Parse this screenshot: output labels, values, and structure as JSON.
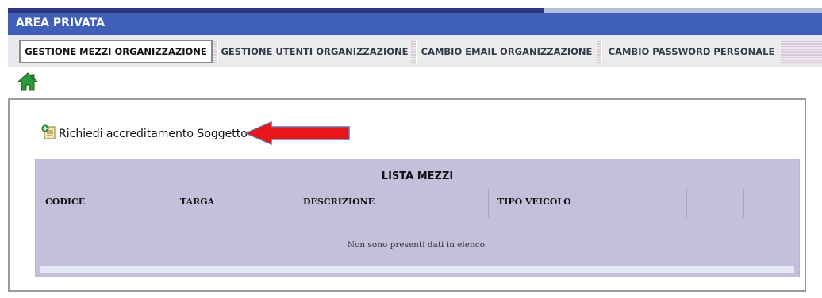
{
  "header": {
    "title": "AREA PRIVATA"
  },
  "tabs": [
    {
      "label": "GESTIONE MEZZI ORGANIZZAZIONE",
      "active": true
    },
    {
      "label": "GESTIONE UTENTI ORGANIZZAZIONE",
      "active": false
    },
    {
      "label": "CAMBIO EMAIL ORGANIZZAZIONE",
      "active": false
    },
    {
      "label": "CAMBIO PASSWORD PERSONALE",
      "active": false
    }
  ],
  "home": {
    "icon": "home-icon"
  },
  "action": {
    "icon": "document-add-icon",
    "label": "Richiedi accreditamento Soggetto"
  },
  "annotation": {
    "icon": "red-arrow-icon",
    "color": "#e8161a"
  },
  "list": {
    "title": "LISTA MEZZI",
    "columns": [
      "CODICE",
      "TARGA",
      "DESCRIZIONE",
      "TIPO VEICOLO"
    ],
    "empty_message": "Non sono presenti dati in elenco."
  },
  "colors": {
    "header": "#4060b8",
    "list_bg": "#c4c0dc"
  }
}
